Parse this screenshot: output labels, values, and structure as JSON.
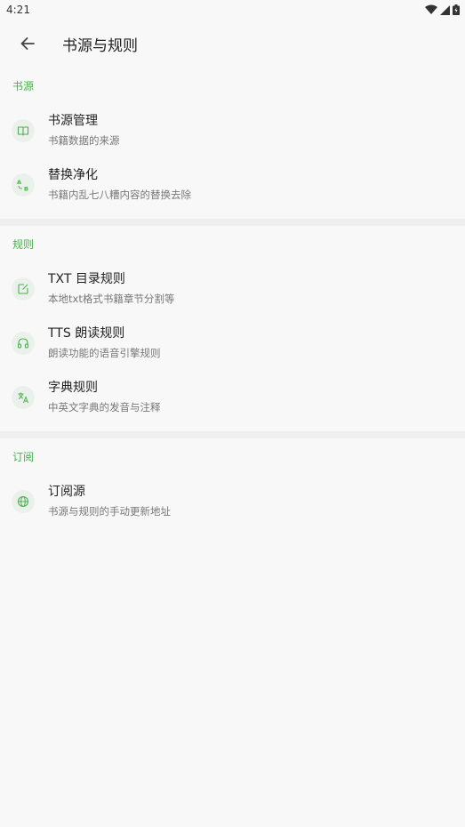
{
  "status": {
    "time": "4:21"
  },
  "app_bar": {
    "title": "书源与规则"
  },
  "sections": [
    {
      "header": "书源",
      "items": [
        {
          "icon": "book-icon",
          "title": "书源管理",
          "subtitle": "书籍数据的来源"
        },
        {
          "icon": "replace-ab-icon",
          "title": "替换净化",
          "subtitle": "书籍内乱七八糟内容的替换去除"
        }
      ]
    },
    {
      "header": "规则",
      "items": [
        {
          "icon": "edit-box-icon",
          "title": "TXT 目录规则",
          "subtitle": "本地txt格式书籍章节分割等"
        },
        {
          "icon": "headphones-icon",
          "title": "TTS 朗读规则",
          "subtitle": "朗读功能的语音引擎规则"
        },
        {
          "icon": "translate-icon",
          "title": "字典规则",
          "subtitle": "中英文字典的发音与注释"
        }
      ]
    },
    {
      "header": "订阅",
      "items": [
        {
          "icon": "globe-icon",
          "title": "订阅源",
          "subtitle": "书源与规则的手动更新地址"
        }
      ]
    }
  ],
  "colors": {
    "accent": "#4caf50",
    "icon_bg": "#eaf1ea",
    "background": "#f8f8f8"
  }
}
